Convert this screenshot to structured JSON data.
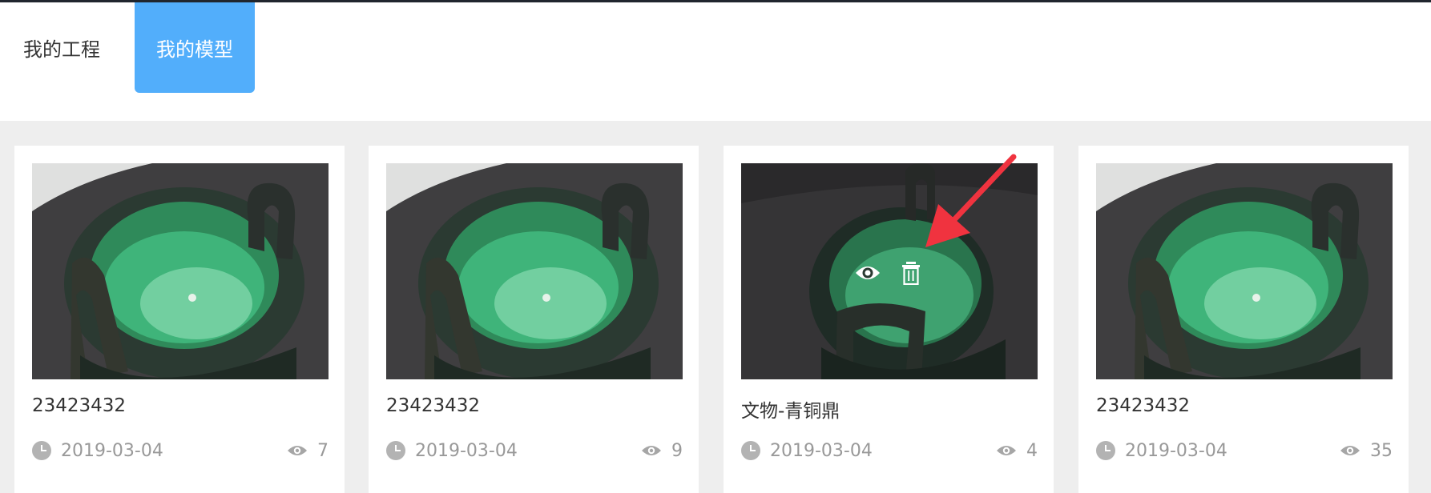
{
  "tabs": [
    {
      "label": "我的工程",
      "active": false
    },
    {
      "label": "我的模型",
      "active": true
    }
  ],
  "accent_color": "#52aefb",
  "annotation_color": "#f0333f",
  "cards": [
    {
      "title": "23423432",
      "date": "2019-03-04",
      "views": "7",
      "image": "bronze-ding-photo"
    },
    {
      "title": "23423432",
      "date": "2019-03-04",
      "views": "9",
      "image": "bronze-ding-photo"
    },
    {
      "title": "文物-青铜鼎",
      "date": "2019-03-04",
      "views": "4",
      "image": "bronze-ding-photo",
      "hover_actions": [
        "eye-icon",
        "trash-icon"
      ]
    },
    {
      "title": "23423432",
      "date": "2019-03-04",
      "views": "35",
      "image": "bronze-ding-photo"
    }
  ]
}
